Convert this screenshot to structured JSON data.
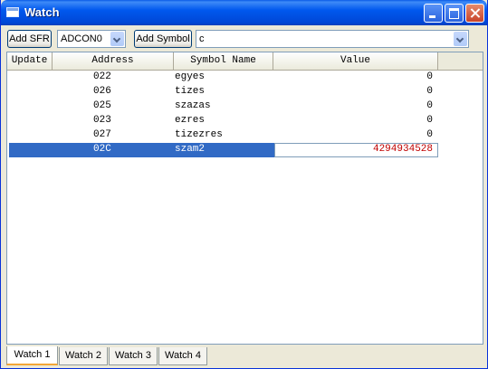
{
  "window": {
    "title": "Watch",
    "icon": "window-icon"
  },
  "toolbar": {
    "add_sfr_label": "Add SFR",
    "sfr_select_value": "ADCON0",
    "add_symbol_label": "Add Symbol",
    "symbol_select_value": "c"
  },
  "columns": [
    "Update",
    "Address",
    "Symbol Name",
    "Value"
  ],
  "rows": [
    {
      "address": "022",
      "symbol": "egyes",
      "value": "0"
    },
    {
      "address": "026",
      "symbol": "tizes",
      "value": "0"
    },
    {
      "address": "025",
      "symbol": "szazas",
      "value": "0"
    },
    {
      "address": "023",
      "symbol": "ezres",
      "value": "0"
    },
    {
      "address": "027",
      "symbol": "tizezres",
      "value": "0"
    },
    {
      "address": "02C",
      "symbol": "szam2",
      "value": "4294934528",
      "selected": true
    }
  ],
  "tabs": [
    "Watch 1",
    "Watch 2",
    "Watch 3",
    "Watch 4"
  ],
  "active_tab": "Watch 1",
  "colors": {
    "selection": "#316ac5",
    "changed_value": "#c00000",
    "title_bar": "#0058ee"
  }
}
